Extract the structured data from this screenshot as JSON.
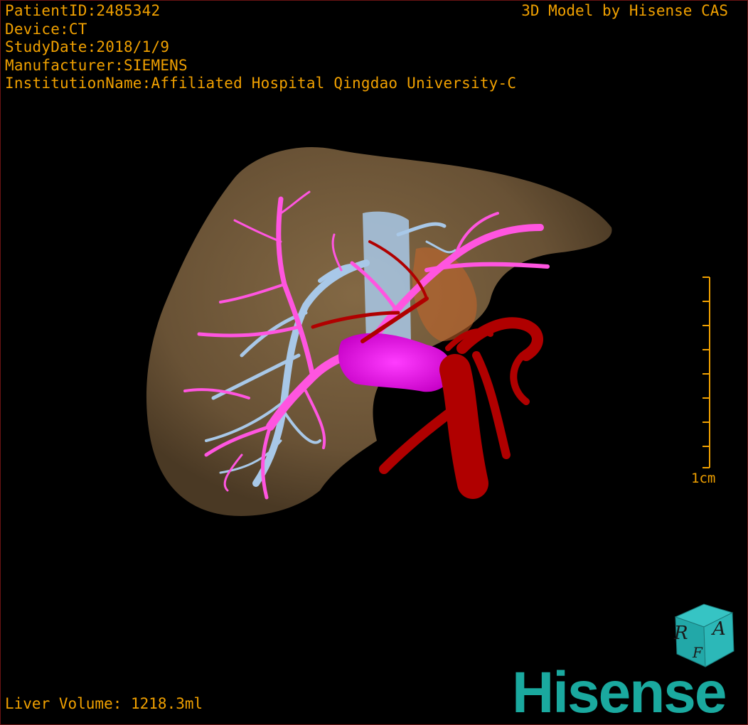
{
  "header": {
    "patient_id": "PatientID:2485342",
    "device": "Device:CT",
    "study_date": "StudyDate:2018/1/9",
    "manufacturer": "Manufacturer:SIEMENS",
    "institution": "InstitutionName:Affiliated Hospital Qingdao University-C",
    "credit": "3D Model by Hisense CAS"
  },
  "footer": {
    "liver_volume": "Liver Volume: 1218.3ml",
    "brand": "Hisense"
  },
  "scale_bar": {
    "label": "1cm"
  },
  "orientation_cube": {
    "face_r": "R",
    "face_a": "A",
    "face_f": "F"
  },
  "colors": {
    "background": "#000000",
    "overlay_text": "#f0a000",
    "liver": "#7a6240",
    "portal_vein": "#ff55e0",
    "hepatic_vein": "#a8c8e8",
    "artery": "#b00000",
    "brand": "#1aa99f"
  }
}
